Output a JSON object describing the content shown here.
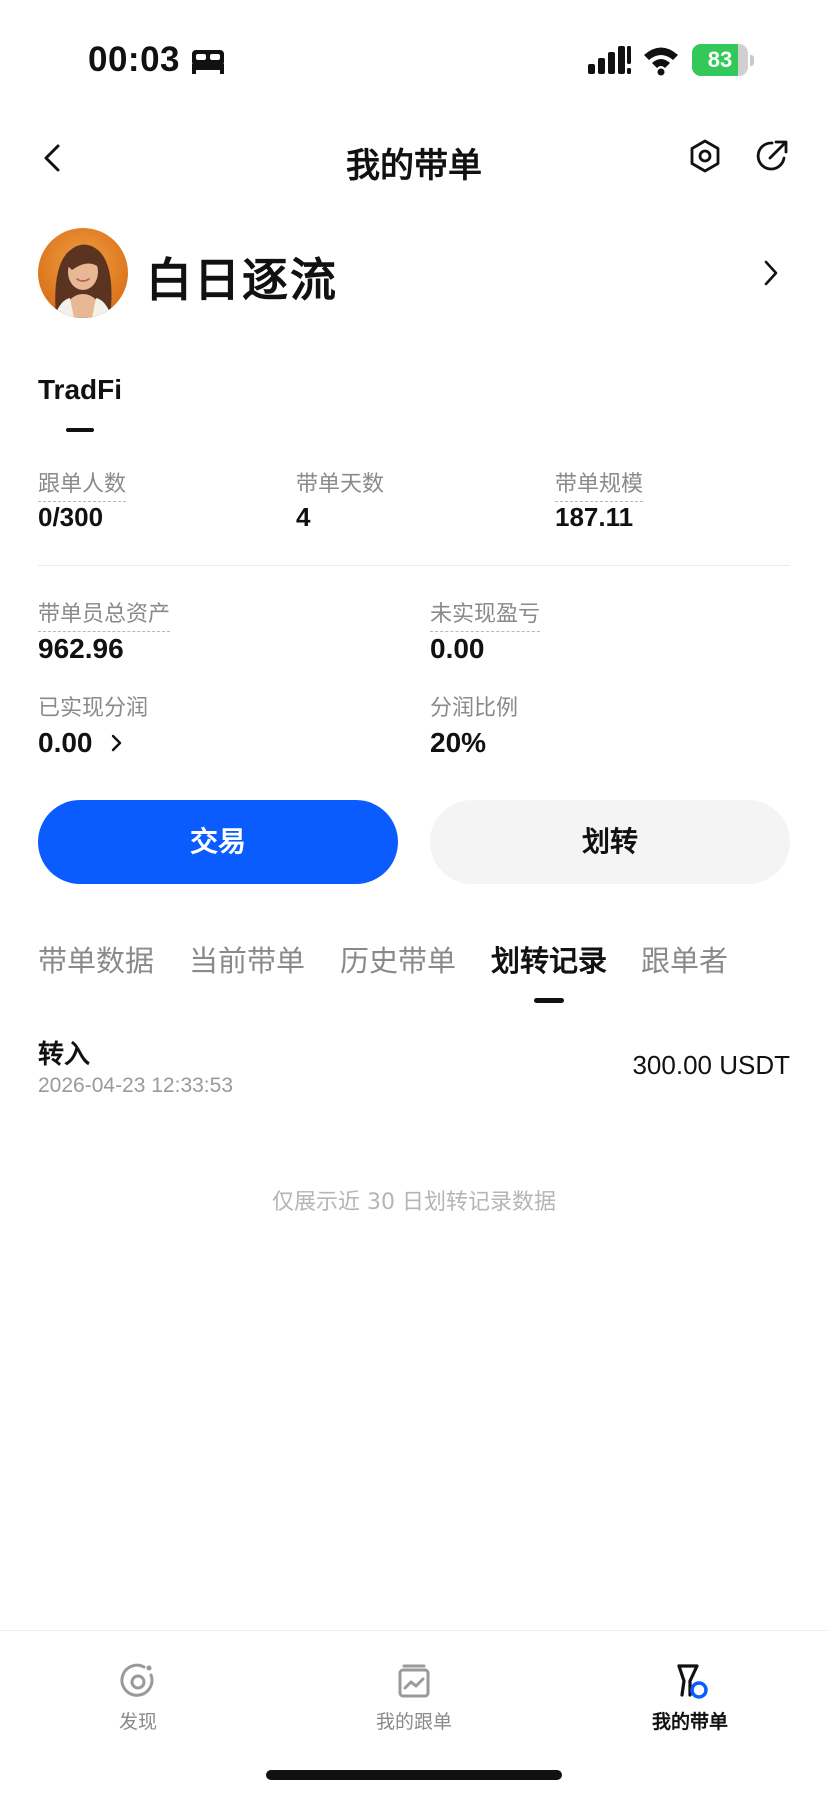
{
  "status_bar": {
    "time": "00:03",
    "battery": "83",
    "battery_level": 0.83
  },
  "nav": {
    "title": "我的带单"
  },
  "profile": {
    "name": "白日逐流"
  },
  "account_tab": {
    "label": "TradFi"
  },
  "stats": {
    "followers_label": "跟单人数",
    "followers_value": "0/300",
    "days_label": "带单天数",
    "days_value": "4",
    "scale_label": "带单规模",
    "scale_value": "187.11",
    "total_assets_label": "带单员总资产",
    "total_assets_value": "962.96",
    "unrealized_label": "未实现盈亏",
    "unrealized_value": "0.00",
    "realized_label": "已实现分润",
    "realized_value": "0.00",
    "share_ratio_label": "分润比例",
    "share_ratio_value": "20%"
  },
  "actions": {
    "trade_label": "交易",
    "transfer_label": "划转"
  },
  "tabs": [
    {
      "label": "带单数据"
    },
    {
      "label": "当前带单"
    },
    {
      "label": "历史带单"
    },
    {
      "label": "划转记录"
    },
    {
      "label": "跟单者"
    }
  ],
  "active_tab": "划转记录",
  "records": [
    {
      "type": "转入",
      "time": "2026-04-23 12:33:53",
      "amount": "300.00 USDT"
    }
  ],
  "records_note": "仅展示近 30 日划转记录数据",
  "bottom_nav": [
    {
      "label": "发现",
      "icon": "discover-icon"
    },
    {
      "label": "我的跟单",
      "icon": "copy-orders-icon"
    },
    {
      "label": "我的带单",
      "icon": "lead-orders-icon"
    }
  ],
  "colors": {
    "primary": "#0a5cff",
    "battery_green": "#34c759"
  }
}
